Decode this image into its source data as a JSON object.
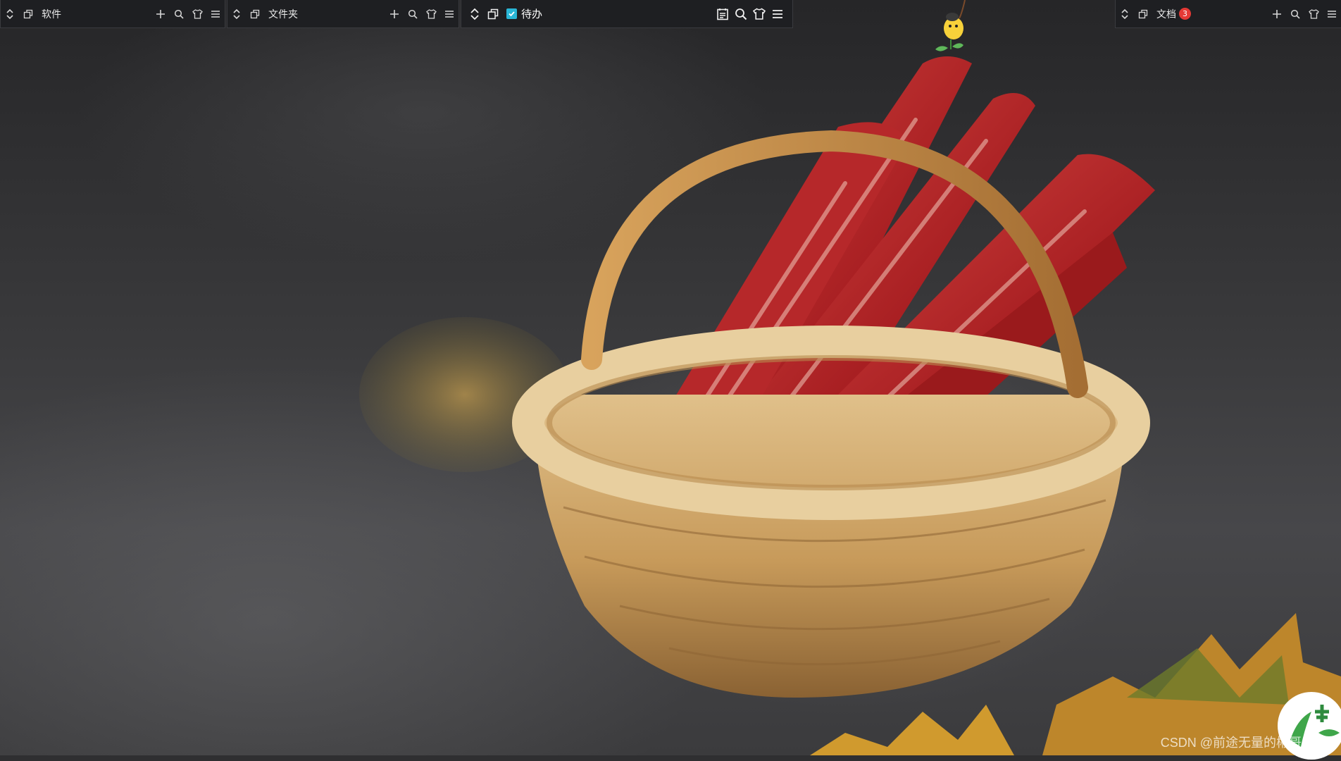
{
  "desktop": {
    "wallpaper_description_icon": "basket-with-sausages-wallpaper",
    "watermark": "CSDN @前途无量的彬哥"
  },
  "fences": [
    {
      "title": "软件",
      "icons": [
        "collapse-expand-icon",
        "fence-window-icon",
        "add-icon",
        "search-icon",
        "shirt-icon",
        "menu-icon"
      ]
    },
    {
      "title": "文件夹",
      "icons": [
        "collapse-expand-icon",
        "fence-window-icon",
        "add-icon",
        "search-icon",
        "shirt-icon",
        "menu-icon"
      ]
    },
    {
      "title": "待办",
      "icons": [
        "collapse-expand-icon",
        "fence-window-icon",
        "checkbox-icon",
        "calendar-icon",
        "search-icon",
        "shirt-icon",
        "menu-icon"
      ]
    },
    {
      "title": "文档",
      "badge": "3",
      "icons": [
        "collapse-expand-icon",
        "fence-window-icon",
        "add-icon",
        "search-icon",
        "shirt-icon",
        "menu-icon"
      ]
    }
  ],
  "colors": {
    "fence_bg": "#1e1f22",
    "check_accent": "#29b6d6",
    "badge_red": "#e53935"
  }
}
